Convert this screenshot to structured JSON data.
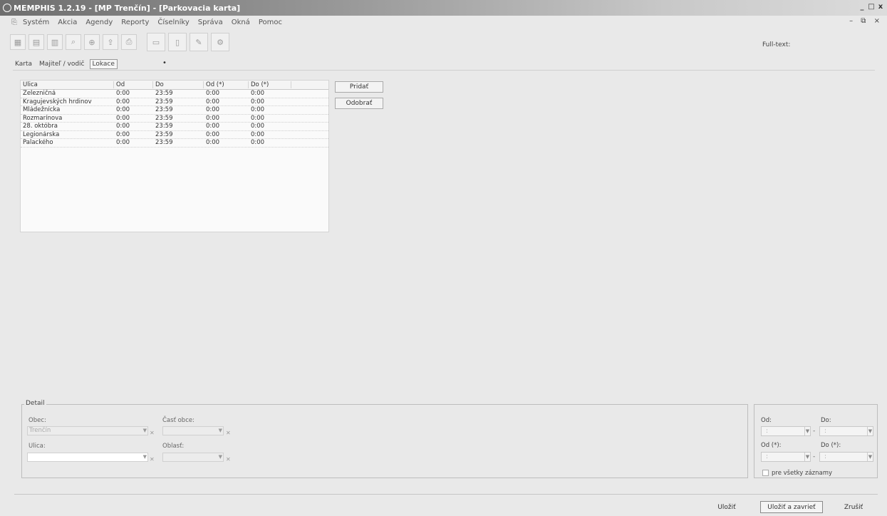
{
  "window": {
    "title": "MEMPHIS 1.2.19 - [MP Trenčín] - [Parkovacia karta]",
    "controls": [
      "_",
      "□",
      "x"
    ]
  },
  "menubar": {
    "items": [
      "Systém",
      "Akcia",
      "Agendy",
      "Reporty",
      "Číselníky",
      "Správa",
      "Okná",
      "Pomoc"
    ]
  },
  "toolbar": {
    "icons": [
      "grid-icon",
      "table-icon",
      "chart-icon",
      "search-icon",
      "search-plus-icon",
      "export-icon",
      "print-icon",
      "window-icon",
      "document-icon",
      "edit-icon",
      "tools-icon"
    ]
  },
  "fulltext_label": "Full-text:",
  "tabs": [
    "Karta",
    "Majiteľ / vodič",
    "Lokace"
  ],
  "grid": {
    "columns": [
      "Ulica",
      "Od",
      "Do",
      "Od (*)",
      "Do (*)"
    ],
    "rows": [
      [
        "Železničná",
        "0:00",
        "23:59",
        "0:00",
        "0:00"
      ],
      [
        "Kragujevských hrdinov",
        "0:00",
        "23:59",
        "0:00",
        "0:00"
      ],
      [
        "Mládežnícka",
        "0:00",
        "23:59",
        "0:00",
        "0:00"
      ],
      [
        "Rozmarínova",
        "0:00",
        "23:59",
        "0:00",
        "0:00"
      ],
      [
        "28. októbra",
        "0:00",
        "23:59",
        "0:00",
        "0:00"
      ],
      [
        "Legionárska",
        "0:00",
        "23:59",
        "0:00",
        "0:00"
      ],
      [
        "Palackého",
        "0:00",
        "23:59",
        "0:00",
        "0:00"
      ]
    ]
  },
  "side_buttons": {
    "add": "Pridať",
    "remove": "Odobrať"
  },
  "detail": {
    "legend": "Detail",
    "obec_label": "Obec:",
    "obec_value": "Trenčín",
    "cast_obce_label": "Časť obce:",
    "ulica_label": "Ulica:",
    "oblast_label": "Oblasť:"
  },
  "time": {
    "od_label": "Od:",
    "do_label": "Do:",
    "od_star_label": "Od (*):",
    "do_star_label": "Do (*):",
    "placeholder": ":",
    "all_records_label": "pre všetky záznamy"
  },
  "footer": {
    "save": "Uložiť",
    "save_close": "Uložiť a zavrieť",
    "cancel": "Zrušiť"
  }
}
